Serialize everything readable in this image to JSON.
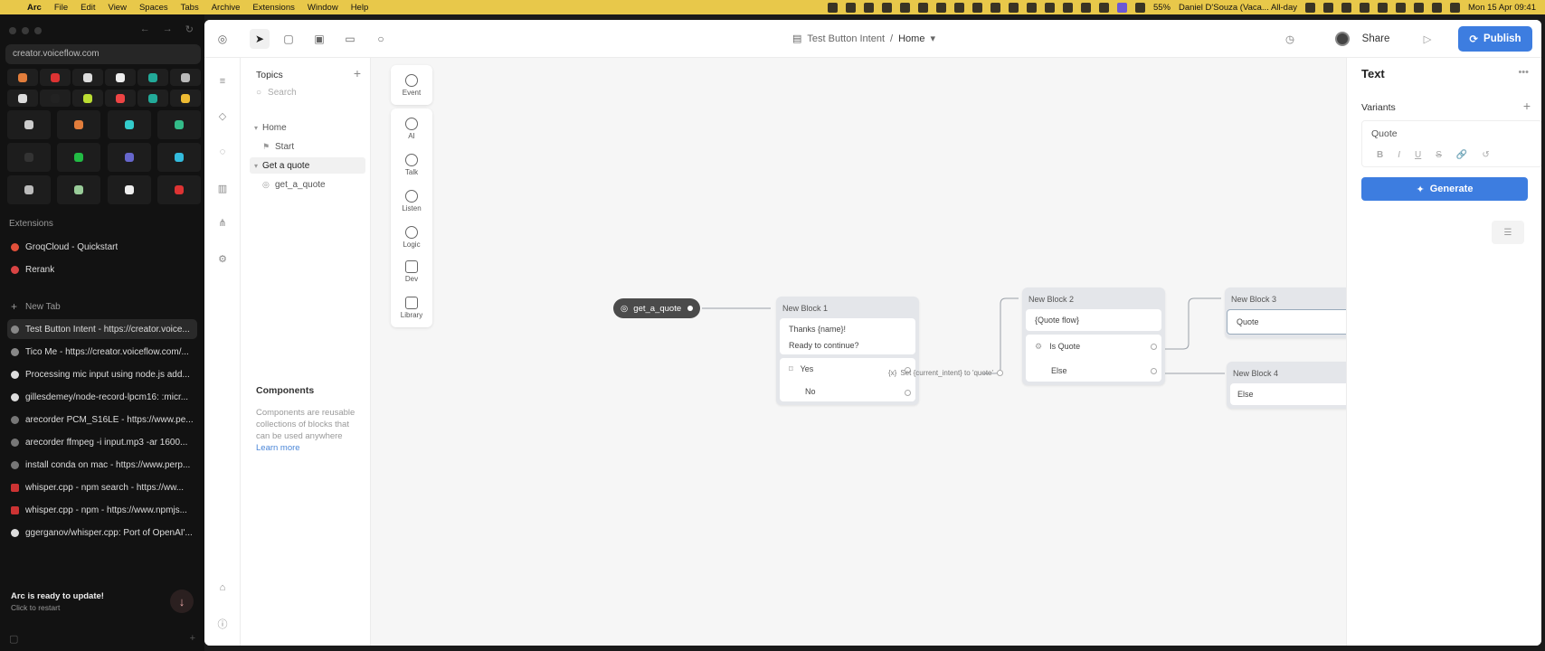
{
  "menubar": {
    "apple": "",
    "items": [
      "Arc",
      "File",
      "Edit",
      "View",
      "Spaces",
      "Tabs",
      "Archive",
      "Extensions",
      "Window",
      "Help"
    ],
    "battery": "55%",
    "event": "Daniel D'Souza (Vaca... All-day",
    "clock": "Mon 15 Apr 09:41"
  },
  "arc": {
    "url": "creator.voiceflow.com",
    "extensions_label": "Extensions",
    "extensions": [
      {
        "label": "GroqCloud - Quickstart",
        "color": "#e2503a"
      },
      {
        "label": "Rerank",
        "color": "#d94444"
      }
    ],
    "new_tab_label": "New Tab",
    "tabs": [
      {
        "label": "Test Button Intent - https://creator.voice...",
        "color": "#555",
        "active": true
      },
      {
        "label": "Tico Me - https://creator.voiceflow.com/...",
        "color": "#555"
      },
      {
        "label": "Processing mic input using node.js add...",
        "color": "#ddd"
      },
      {
        "label": "gillesdemey/node-record-lpcm16: :micr...",
        "color": "#ddd"
      },
      {
        "label": "arecorder PCM_S16LE - https://www.pe...",
        "color": "#666"
      },
      {
        "label": "arecorder ffmpeg -i input.mp3 -ar 1600...",
        "color": "#666"
      },
      {
        "label": "install conda on mac - https://www.perp...",
        "color": "#666"
      },
      {
        "label": "whisper.cpp - npm search - https://ww...",
        "color": "#c33"
      },
      {
        "label": "whisper.cpp - npm - https://www.npmjs...",
        "color": "#c33"
      },
      {
        "label": "ggerganov/whisper.cpp: Port of OpenAI'...",
        "color": "#ddd"
      }
    ],
    "update_title": "Arc is ready to update!",
    "update_sub": "Click to restart"
  },
  "app": {
    "breadcrumb": {
      "project": "Test Button Intent",
      "sep": "/",
      "page": "Home"
    },
    "share": "Share",
    "publish": "Publish"
  },
  "topics": {
    "header": "Topics",
    "search_placeholder": "Search",
    "items": [
      {
        "label": "Home"
      },
      {
        "label": "Start"
      },
      {
        "label": "Get a quote"
      },
      {
        "label": "get_a_quote"
      }
    ],
    "components_header": "Components",
    "components_desc": "Components are reusable collections of blocks that can be used anywhere",
    "learn_more": "Learn more"
  },
  "palette": [
    "Event",
    "AI",
    "Talk",
    "Listen",
    "Logic",
    "Dev",
    "Library"
  ],
  "canvas": {
    "start": "get_a_quote",
    "block1": {
      "title": "New Block 1",
      "text1": "Thanks {name}!",
      "text2": "Ready to continue?",
      "yes": "Yes",
      "no": "No"
    },
    "edge1": "Set {current_intent} to 'quote'",
    "block2": {
      "title": "New Block 2",
      "text": "{Quote flow}",
      "cond": "Is Quote",
      "else": "Else"
    },
    "block3": {
      "title": "New Block 3",
      "text": "Quote"
    },
    "block4": {
      "title": "New Block 4",
      "text": "Else"
    }
  },
  "rpanel": {
    "title": "Text",
    "variants": "Variants",
    "variant_value": "Quote",
    "fmt": [
      "B",
      "I",
      "U",
      "S",
      "🔗",
      "↺"
    ],
    "generate": "Generate"
  }
}
